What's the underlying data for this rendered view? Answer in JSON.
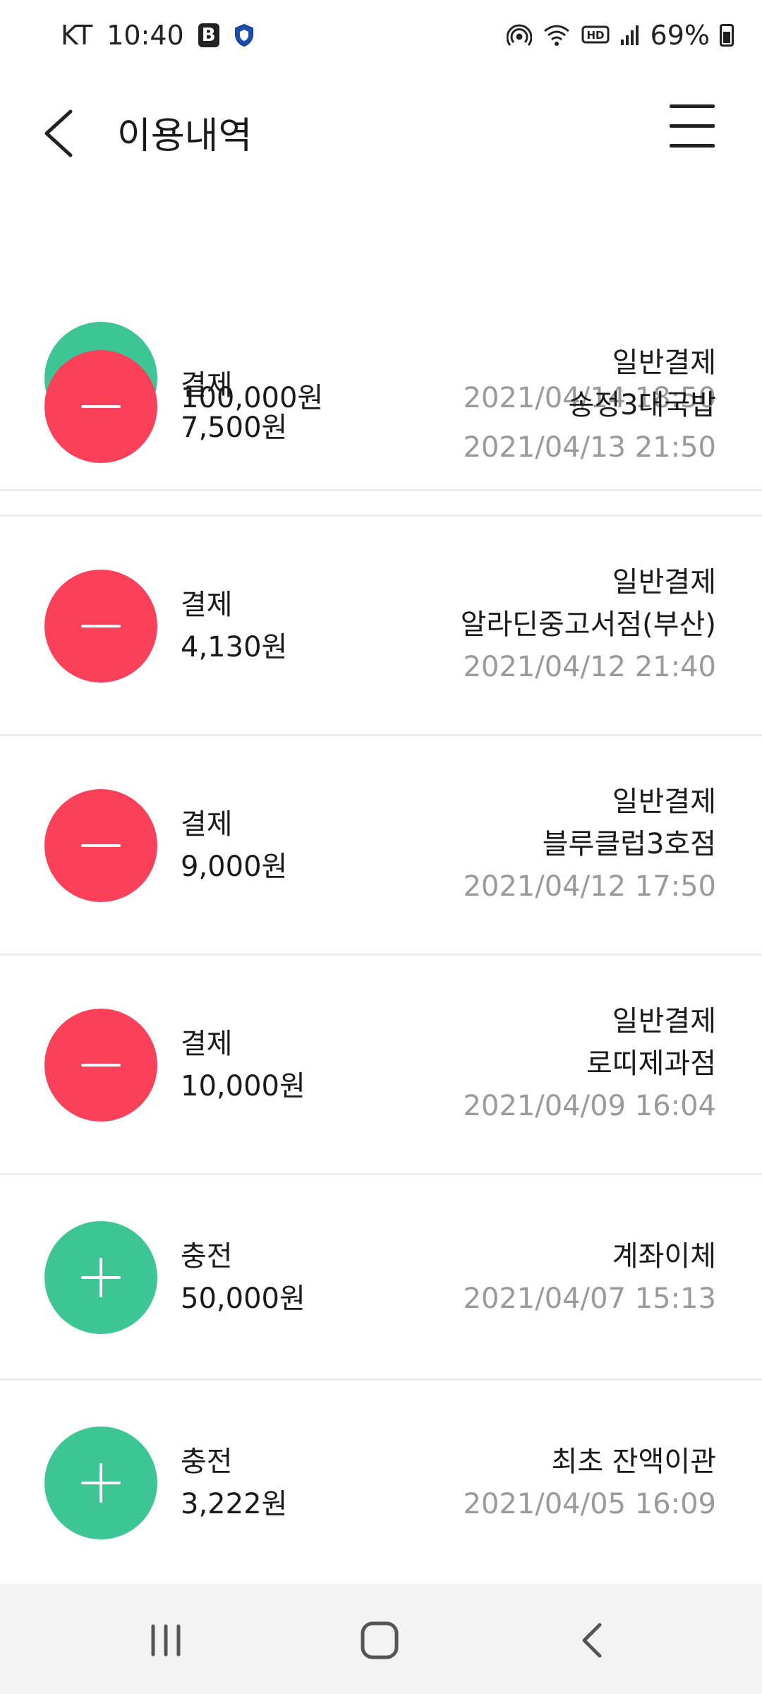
{
  "status_bar": {
    "carrier": "KT",
    "time": "10:40",
    "battery": "69%"
  },
  "header": {
    "title": "이용내역"
  },
  "transactions": [
    {
      "type": "charge",
      "label": "",
      "amount": "100,000원",
      "method": "",
      "merchant": "",
      "datetime": "2021/04/14 18:50"
    },
    {
      "type": "payment",
      "label": "결제",
      "amount": "7,500원",
      "method": "일반결제",
      "merchant": "송정3대국밥",
      "datetime": "2021/04/13 21:50"
    },
    {
      "type": "payment",
      "label": "결제",
      "amount": "4,130원",
      "method": "일반결제",
      "merchant": "알라딘중고서점(부산)",
      "datetime": "2021/04/12 21:40"
    },
    {
      "type": "payment",
      "label": "결제",
      "amount": "9,000원",
      "method": "일반결제",
      "merchant": "블루클럽3호점",
      "datetime": "2021/04/12 17:50"
    },
    {
      "type": "payment",
      "label": "결제",
      "amount": "10,000원",
      "method": "일반결제",
      "merchant": "로띠제과점",
      "datetime": "2021/04/09 16:04"
    },
    {
      "type": "charge",
      "label": "충전",
      "amount": "50,000원",
      "method": "계좌이체",
      "merchant": "",
      "datetime": "2021/04/07 15:13"
    },
    {
      "type": "charge",
      "label": "충전",
      "amount": "3,222원",
      "method": "최초 잔액이관",
      "merchant": "",
      "datetime": "2021/04/05 16:09"
    }
  ],
  "colors": {
    "payment": "#fb4059",
    "charge": "#3ec596",
    "date_text": "#9a9a9a",
    "divider": "#ececec"
  }
}
